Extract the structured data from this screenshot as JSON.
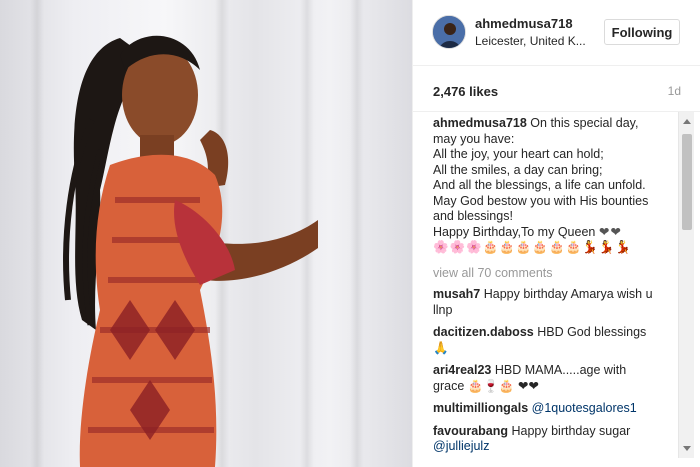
{
  "post": {
    "username": "ahmedmusa718",
    "location": "Leicester, United K...",
    "follow_label": "Following",
    "likes": "2,476 likes",
    "age": "1d"
  },
  "caption": {
    "username": "ahmedmusa718",
    "line1": "On this special day,",
    "line2": "may you have:",
    "line3": "All the joy, your heart can hold;",
    "line4": "All the smiles, a day can bring;",
    "line5": "And all the blessings, a life can unfold.",
    "line6": "May God bestow you with His bounties",
    "line7": "and blessings!",
    "line8": "Happy Birthday,To my Queen",
    "line8_emoji": "❤❤",
    "line9_emoji": "🌸🌸🌸🎂🎂🎂🎂🎂🎂💃💃💃"
  },
  "view_all": "view all 70 comments",
  "comments": [
    {
      "user": "musah7",
      "text": "Happy birthday Amarya wish u",
      "text2": "llnp"
    },
    {
      "user": "dacitizen.daboss",
      "text": "HBD God blessings",
      "text2": "🙏"
    },
    {
      "user": "ari4real23",
      "text": "HBD MAMA.....age with",
      "text2": "grace 🎂🍷🎂 ❤❤"
    },
    {
      "user": "multimilliongals",
      "text": "@1quotesgalores1",
      "text2": ""
    },
    {
      "user": "favourabang",
      "text": "Happy birthday sugar",
      "text2": "@julliejulz"
    }
  ]
}
